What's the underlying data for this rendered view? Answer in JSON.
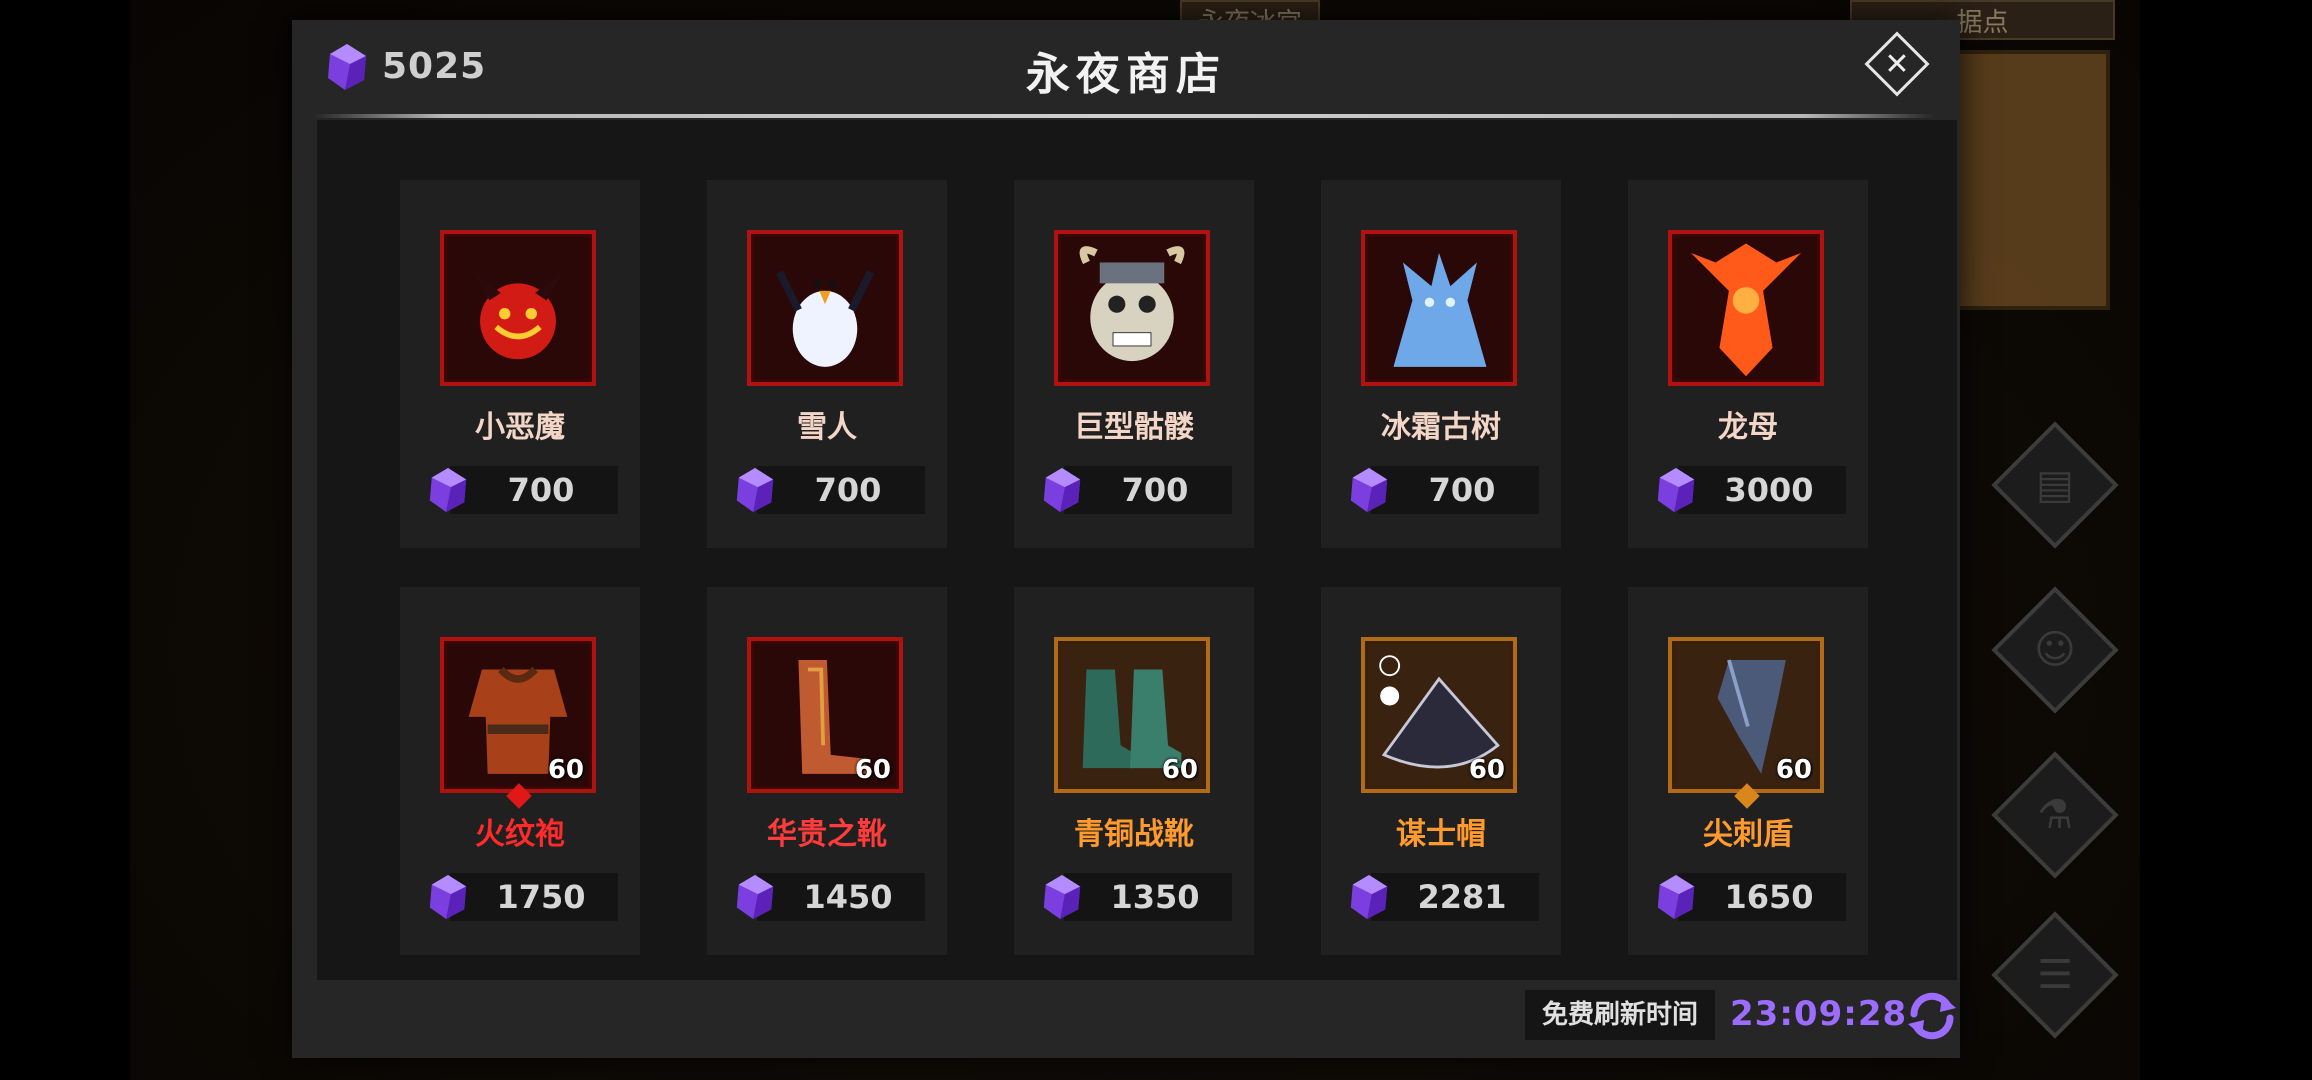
{
  "background": {
    "tab_left": "永夜冰宫",
    "tab_right": "据点"
  },
  "header": {
    "gem_balance": "5025",
    "title": "永夜商店",
    "currency_icon": "purple-crystal-icon",
    "close_icon": "close-icon"
  },
  "items": [
    {
      "name": "小恶魔",
      "price": "700",
      "icon": "imp-icon",
      "name_color": "#f4d6c8",
      "frame": "red"
    },
    {
      "name": "雪人",
      "price": "700",
      "icon": "yeti-icon",
      "name_color": "#f4d6c8",
      "frame": "red"
    },
    {
      "name": "巨型骷髅",
      "price": "700",
      "icon": "giant-skeleton-icon",
      "name_color": "#f4d6c8",
      "frame": "red"
    },
    {
      "name": "冰霜古树",
      "price": "700",
      "icon": "frost-treant-icon",
      "name_color": "#f4d6c8",
      "frame": "red"
    },
    {
      "name": "龙母",
      "price": "3000",
      "icon": "dragon-mother-icon",
      "name_color": "#f4d6c8",
      "frame": "red"
    },
    {
      "name": "火纹袍",
      "price": "1750",
      "icon": "fire-robe-icon",
      "level": "60",
      "name_color": "#ff2a2a",
      "frame": "red",
      "rarity_color": "#e01818"
    },
    {
      "name": "华贵之靴",
      "price": "1450",
      "icon": "noble-boots-icon",
      "level": "60",
      "name_color": "#ff3b3b",
      "frame": "red"
    },
    {
      "name": "青铜战靴",
      "price": "1350",
      "icon": "bronze-war-boots-icon",
      "level": "60",
      "name_color": "#ff9a2e",
      "frame": "orange"
    },
    {
      "name": "谋士帽",
      "price": "2281",
      "icon": "strategist-hat-icon",
      "level": "60",
      "name_color": "#ff9a2e",
      "frame": "orange"
    },
    {
      "name": "尖刺盾",
      "price": "1650",
      "icon": "spiked-shield-icon",
      "level": "60",
      "name_color": "#ff9a2e",
      "frame": "orange",
      "rarity_color": "#d9861c"
    }
  ],
  "footer": {
    "refresh_label": "免费刷新时间",
    "refresh_timer": "23:09:28",
    "refresh_icon": "refresh-icon"
  },
  "colors": {
    "accent_purple": "#9c6cff",
    "frame_red": "#b0120f",
    "frame_orange": "#b06a18"
  }
}
